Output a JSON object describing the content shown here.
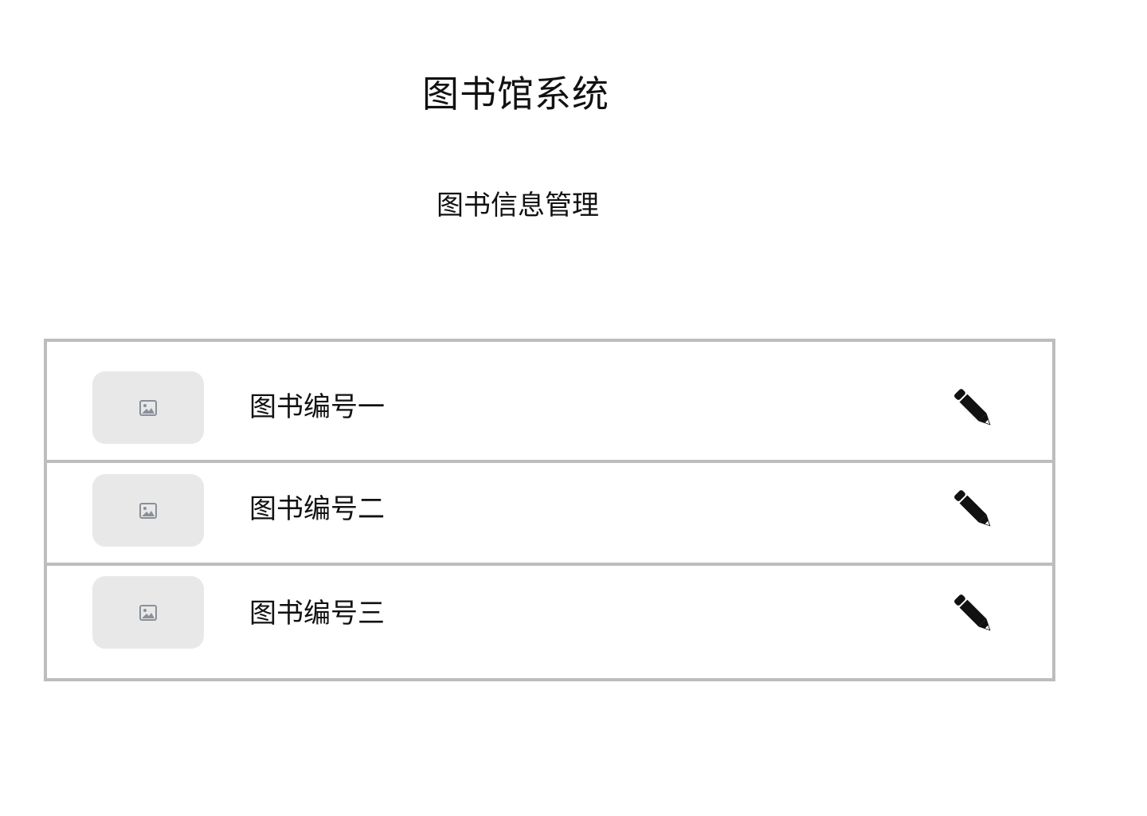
{
  "app": {
    "title": "图书馆系统"
  },
  "section": {
    "title": "图书信息管理"
  },
  "books": [
    {
      "label": "图书编号一",
      "thumbnail_icon": "image-placeholder-icon",
      "action_icon": "pencil-icon"
    },
    {
      "label": "图书编号二",
      "thumbnail_icon": "image-placeholder-icon",
      "action_icon": "pencil-icon"
    },
    {
      "label": "图书编号三",
      "thumbnail_icon": "image-placeholder-icon",
      "action_icon": "pencil-icon"
    }
  ],
  "colors": {
    "border": "#bdbdbd",
    "thumbnail_bg": "#e8e8e8",
    "text": "#111111",
    "icon_gray": "#8a9099"
  }
}
